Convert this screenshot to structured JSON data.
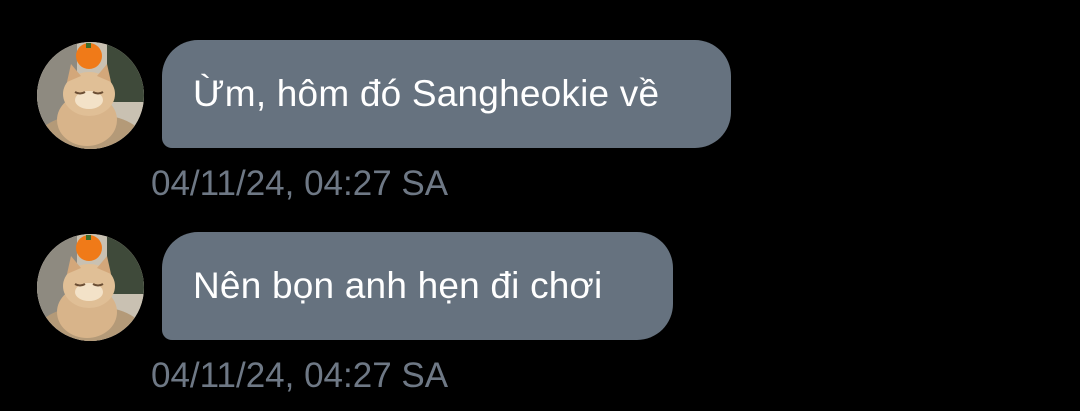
{
  "messages": [
    {
      "text": "Ừm, hôm đó Sangheokie về",
      "timestamp": "04/11/24, 04:27 SA",
      "avatar_icon": "orange-cat-with-orange-on-head-avatar"
    },
    {
      "text": "Nên bọn anh hẹn đi chơi",
      "timestamp": "04/11/24, 04:27 SA",
      "avatar_icon": "orange-cat-with-orange-on-head-avatar"
    }
  ],
  "colors": {
    "background": "#000000",
    "bubble": "#66727f",
    "bubble_text": "#ffffff",
    "timestamp": "#6e7885"
  }
}
